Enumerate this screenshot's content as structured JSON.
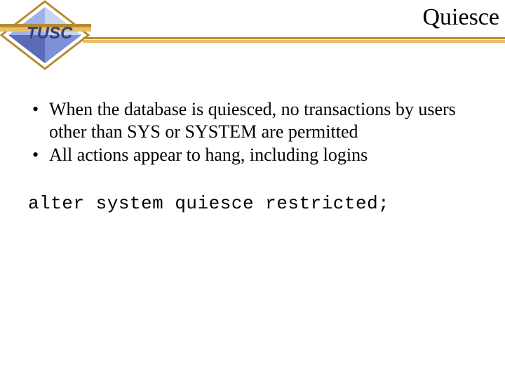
{
  "header": {
    "title": "Quiesce",
    "logo_text": "TUSC",
    "brand_gold_dark": "#b78a2e",
    "brand_gold_light": "#e9c06a",
    "brand_blue": "#2f3d7a",
    "brand_blue_light": "#6a78b8"
  },
  "bullets": [
    "When the database is quiesced, no transactions by users other than SYS or SYSTEM are permitted",
    "All actions appear to hang, including logins"
  ],
  "code": "alter system quiesce restricted;"
}
